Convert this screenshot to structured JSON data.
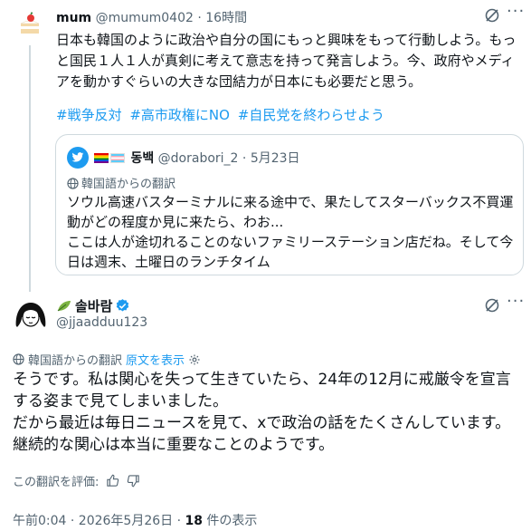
{
  "reply_tweet": {
    "display_name": "mum",
    "handle": "@mumum0402",
    "separator": "·",
    "time": "16時間",
    "text": "日本も韓国のように政治や自分の国にもっと興味をもって行動しよう。もっと国民１人１人が真剣に考えて意志を持って発言しよう。今、政府やメディアを動かすぐらいの大きな団結力が日本にも必要だと思う。",
    "hashtags": [
      "#戦争反対",
      "#高市政権にNO",
      "#自民党を終わらせよう"
    ],
    "more_label": "···"
  },
  "quoted_tweet": {
    "display_name": "동백",
    "handle": "@dorabori_2",
    "separator": "·",
    "date": "5月23日",
    "translation_label": "韓国語からの翻訳",
    "text_line1": "ソウル高速バスターミナルに来る途中で、果たしてスターバックス不買運動がどの程度か見に来たら、わお...",
    "text_line2": "ここは人が途切れることのないファミリーステーション店だね。そして今日は週末、土曜日のランチタイム"
  },
  "main_tweet": {
    "display_name": "솔바람",
    "handle": "@jjaadduu123",
    "translation_label": "韓国語からの翻訳",
    "show_original_label": "原文を表示",
    "text_line1": "そうです。私は関心を失って生きていたら、24年の12月に戒厳令を宣言する姿まで見てしまいました。",
    "text_line2": "だから最近は毎日ニュースを見て、xで政治の話をたくさんしています。継続的な関心は本当に重要なことのようです。",
    "rate_label": "この翻訳を評価:",
    "timestamp": "午前0:04 · 2026年5月26日 · ",
    "views_count": "18",
    "views_label": " 件の表示",
    "more_label": "···"
  },
  "colors": {
    "link": "#1d9bf0",
    "muted": "#536471",
    "border": "#cfd9de",
    "verified": "#1d9bf0"
  },
  "icons": [
    "cake-avatar",
    "grok-icon",
    "bird-icon",
    "globe-icon",
    "gear-icon",
    "thumbs-up-icon",
    "thumbs-down-icon",
    "verified-badge-icon",
    "leaf-icon"
  ]
}
